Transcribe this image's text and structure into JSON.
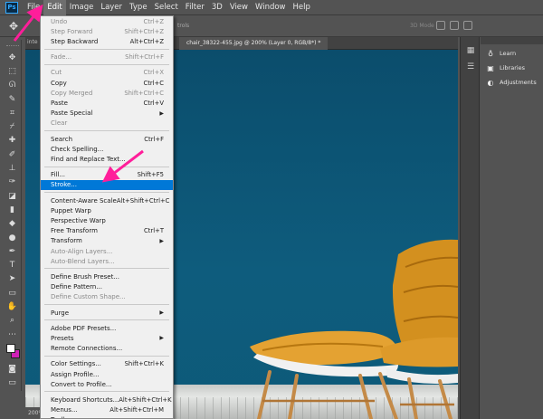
{
  "app": {
    "logo": "Ps"
  },
  "menubar": [
    "File",
    "Edit",
    "Image",
    "Layer",
    "Type",
    "Select",
    "Filter",
    "3D",
    "View",
    "Window",
    "Help"
  ],
  "options": {
    "partial_label": "trols",
    "three_d_mode": "3D Mode"
  },
  "tabs": {
    "left_fragment": "inte",
    "active": "chair_38322-455.jpg @ 200% (Layer 0, RGB/8*) *"
  },
  "status": {
    "zoom": "200%"
  },
  "colors": {
    "foreground": "#ffffff",
    "background": "#d01fb6",
    "accent": "#0078d7",
    "annotation": "#ff1e9a"
  },
  "tools": [
    "move-icon",
    "marquee-icon",
    "lasso-icon",
    "quick-select-icon",
    "crop-icon",
    "eyedropper-icon",
    "healing-icon",
    "brush-icon",
    "stamp-icon",
    "history-brush-icon",
    "eraser-icon",
    "gradient-icon",
    "blur-icon",
    "dodge-icon",
    "pen-icon",
    "type-icon",
    "path-select-icon",
    "rectangle-icon",
    "hand-icon",
    "zoom-icon",
    "more-icon"
  ],
  "right_panel": {
    "items": [
      {
        "label": "Learn",
        "icon": "lightbulb-icon"
      },
      {
        "label": "Libraries",
        "icon": "libraries-icon"
      },
      {
        "label": "Adjustments",
        "icon": "adjustments-icon"
      }
    ]
  },
  "edit_menu": {
    "groups": [
      [
        {
          "label": "Undo",
          "shortcut": "Ctrl+Z",
          "disabled": true
        },
        {
          "label": "Step Forward",
          "shortcut": "Shift+Ctrl+Z",
          "disabled": true
        },
        {
          "label": "Step Backward",
          "shortcut": "Alt+Ctrl+Z",
          "disabled": false
        }
      ],
      [
        {
          "label": "Fade...",
          "shortcut": "Shift+Ctrl+F",
          "disabled": true
        }
      ],
      [
        {
          "label": "Cut",
          "shortcut": "Ctrl+X",
          "disabled": true
        },
        {
          "label": "Copy",
          "shortcut": "Ctrl+C",
          "disabled": false
        },
        {
          "label": "Copy Merged",
          "shortcut": "Shift+Ctrl+C",
          "disabled": true
        },
        {
          "label": "Paste",
          "shortcut": "Ctrl+V",
          "disabled": false
        },
        {
          "label": "Paste Special",
          "submenu": true,
          "disabled": false
        },
        {
          "label": "Clear",
          "disabled": true
        }
      ],
      [
        {
          "label": "Search",
          "shortcut": "Ctrl+F",
          "disabled": false
        },
        {
          "label": "Check Spelling...",
          "disabled": false
        },
        {
          "label": "Find and Replace Text...",
          "disabled": false
        }
      ],
      [
        {
          "label": "Fill...",
          "shortcut": "Shift+F5",
          "disabled": false
        },
        {
          "label": "Stroke...",
          "highlighted": true,
          "disabled": false
        }
      ],
      [
        {
          "label": "Content-Aware Scale",
          "shortcut": "Alt+Shift+Ctrl+C",
          "disabled": false
        },
        {
          "label": "Puppet Warp",
          "disabled": false
        },
        {
          "label": "Perspective Warp",
          "disabled": false
        },
        {
          "label": "Free Transform",
          "shortcut": "Ctrl+T",
          "disabled": false
        },
        {
          "label": "Transform",
          "submenu": true,
          "disabled": false
        },
        {
          "label": "Auto-Align Layers...",
          "disabled": true
        },
        {
          "label": "Auto-Blend Layers...",
          "disabled": true
        }
      ],
      [
        {
          "label": "Define Brush Preset...",
          "disabled": false
        },
        {
          "label": "Define Pattern...",
          "disabled": false
        },
        {
          "label": "Define Custom Shape...",
          "disabled": true
        }
      ],
      [
        {
          "label": "Purge",
          "submenu": true,
          "disabled": false
        }
      ],
      [
        {
          "label": "Adobe PDF Presets...",
          "disabled": false
        },
        {
          "label": "Presets",
          "submenu": true,
          "disabled": false
        },
        {
          "label": "Remote Connections...",
          "disabled": false
        }
      ],
      [
        {
          "label": "Color Settings...",
          "shortcut": "Shift+Ctrl+K",
          "disabled": false
        },
        {
          "label": "Assign Profile...",
          "disabled": false
        },
        {
          "label": "Convert to Profile...",
          "disabled": false
        }
      ],
      [
        {
          "label": "Keyboard Shortcuts...",
          "shortcut": "Alt+Shift+Ctrl+K",
          "disabled": false
        },
        {
          "label": "Menus...",
          "shortcut": "Alt+Shift+Ctrl+M",
          "disabled": false
        },
        {
          "label": "Toolbar...",
          "disabled": false
        }
      ]
    ]
  }
}
